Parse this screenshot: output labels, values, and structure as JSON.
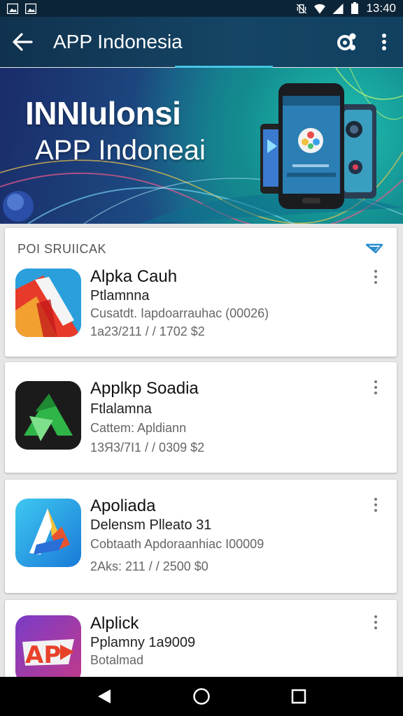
{
  "status_bar": {
    "time": "13:40",
    "icons": [
      "image-icon",
      "image-icon",
      "vibrate-icon",
      "wifi-icon",
      "signal-icon",
      "battery-icon"
    ]
  },
  "app_bar": {
    "title": "APP Indonesia",
    "actions": [
      "back-icon",
      "share-icon",
      "more-vert-icon"
    ]
  },
  "banner": {
    "heading": "INNIulonsi",
    "subheading": "APP Indoneai"
  },
  "list": {
    "section_title": "POI SRUIICAK",
    "apps": [
      {
        "name": "Alpka Cauh",
        "developer": "Ptlamnna",
        "category": "Cusatdt. Iapdoarrauhac (00026)",
        "meta": "1a23/211  / / 1702  $2",
        "icon": "red-white-a-logo"
      },
      {
        "name": "Applkp Soadia",
        "developer": "Ftlalamna",
        "category": "Cattem: Apldiann",
        "meta": "13Я3/7I1  / / 0309  $2",
        "icon": "green-arrow-logo"
      },
      {
        "name": "Apoliada",
        "developer": "Delensm  Plleato 31",
        "category": "Cobtaath Apdoraanhiac I00009",
        "meta": "2Aks: 211  / / 2500  $0",
        "icon": "blue-a-logo"
      },
      {
        "name": "Alplick",
        "developer": "Pplamny 1a9009",
        "category": "Botalmad",
        "meta": "",
        "icon": "ap-logo"
      }
    ]
  },
  "colors": {
    "app_bar": "#10324e",
    "accent": "#46c6e6",
    "card": "#ffffff",
    "background": "#e6e6e6"
  }
}
